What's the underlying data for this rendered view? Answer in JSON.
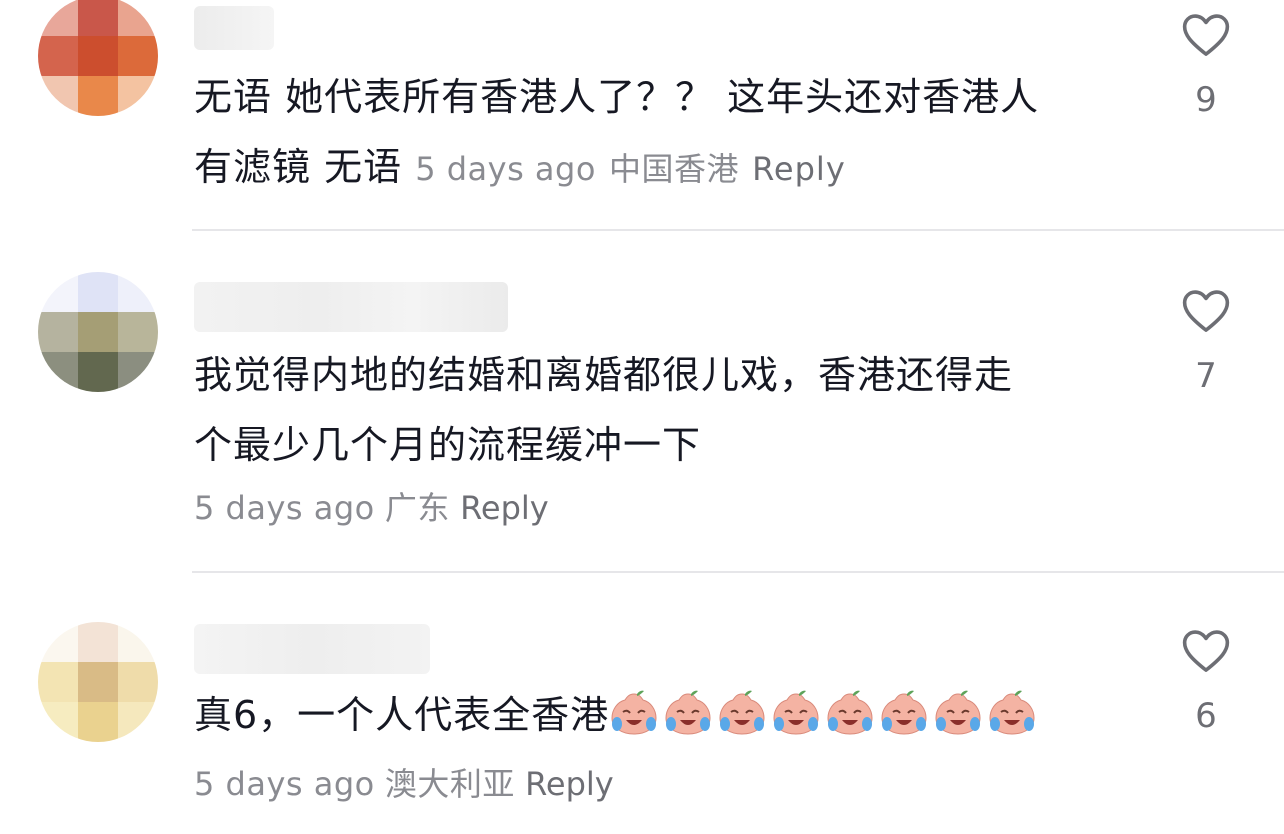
{
  "comments": [
    {
      "text_line1": "无语 她代表所有香港人了？？  这年头还对香港人",
      "text_line2": "有滤镜 无语",
      "time": "5 days ago",
      "location": "中国香港",
      "reply": "Reply",
      "likes": "9",
      "avatar_colors": [
        "#e8a79a",
        "#c9574a",
        "#e9a48f",
        "#d4644d",
        "#cc4e2e",
        "#dc6a3a",
        "#f1c6b0",
        "#e9884a",
        "#f4c3a1"
      ]
    },
    {
      "text_line1": "我觉得内地的结婚和离婚都很儿戏，香港还得走",
      "text_line2": "个最少几个月的流程缓冲一下",
      "time": "5 days ago",
      "location": "广东",
      "reply": "Reply",
      "likes": "7",
      "avatar_colors": [
        "#f3f4fb",
        "#dfe3f6",
        "#eef0fa",
        "#b5b39f",
        "#a59e75",
        "#b8b59a",
        "#8c8f7f",
        "#62684f",
        "#8b8e80"
      ]
    },
    {
      "text_line1": "真6，一个人代表全香港",
      "emoji_count": 8,
      "time": "5 days ago",
      "location": "澳大利亚",
      "reply": "Reply",
      "likes": "6",
      "avatar_colors": [
        "#fbf7ef",
        "#f3e3d6",
        "#faf6ec",
        "#f3e4b3",
        "#d9bb86",
        "#efdcaa",
        "#f6ecc0",
        "#ead28f",
        "#f5e8bd"
      ]
    }
  ],
  "icons": {
    "like": "heart-outline-icon",
    "emoji": "crying-laughing-peach-emoji"
  }
}
